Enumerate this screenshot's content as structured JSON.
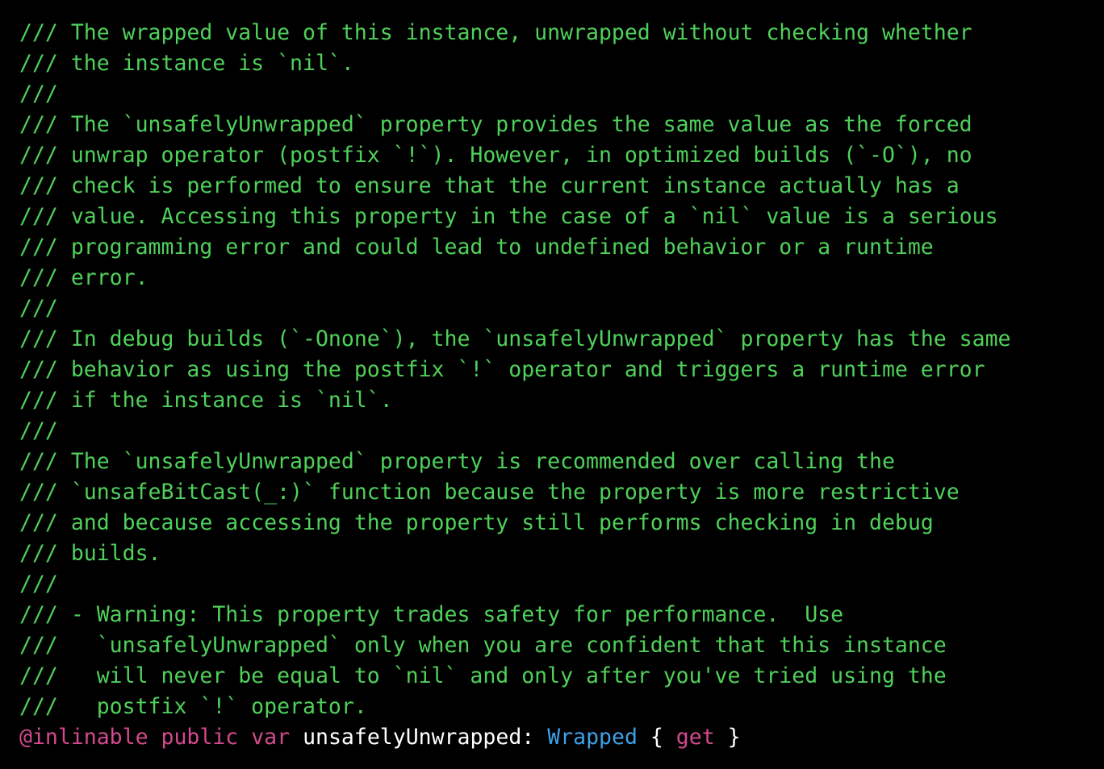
{
  "colors": {
    "background": "#000000",
    "comment": "#4fd05a",
    "keyword": "#d4498e",
    "type": "#3ea1e8",
    "plain": "#ffffff"
  },
  "doc_comment": [
    "/// The wrapped value of this instance, unwrapped without checking whether",
    "/// the instance is `nil`.",
    "///",
    "/// The `unsafelyUnwrapped` property provides the same value as the forced",
    "/// unwrap operator (postfix `!`). However, in optimized builds (`-O`), no",
    "/// check is performed to ensure that the current instance actually has a",
    "/// value. Accessing this property in the case of a `nil` value is a serious",
    "/// programming error and could lead to undefined behavior or a runtime",
    "/// error.",
    "///",
    "/// In debug builds (`-Onone`), the `unsafelyUnwrapped` property has the same",
    "/// behavior as using the postfix `!` operator and triggers a runtime error",
    "/// if the instance is `nil`.",
    "///",
    "/// The `unsafelyUnwrapped` property is recommended over calling the",
    "/// `unsafeBitCast(_:)` function because the property is more restrictive",
    "/// and because accessing the property still performs checking in debug",
    "/// builds.",
    "///",
    "/// - Warning: This property trades safety for performance.  Use",
    "///   `unsafelyUnwrapped` only when you are confident that this instance",
    "///   will never be equal to `nil` and only after you've tried using the",
    "///   postfix `!` operator."
  ],
  "declaration": {
    "attribute": "@inlinable",
    "sp1": " ",
    "access": "public",
    "sp2": " ",
    "keyword": "var",
    "sp3": " ",
    "name": "unsafelyUnwrapped",
    "colon": ": ",
    "type": "Wrapped",
    "open_brace": " { ",
    "accessor": "get",
    "close_brace": " }"
  }
}
